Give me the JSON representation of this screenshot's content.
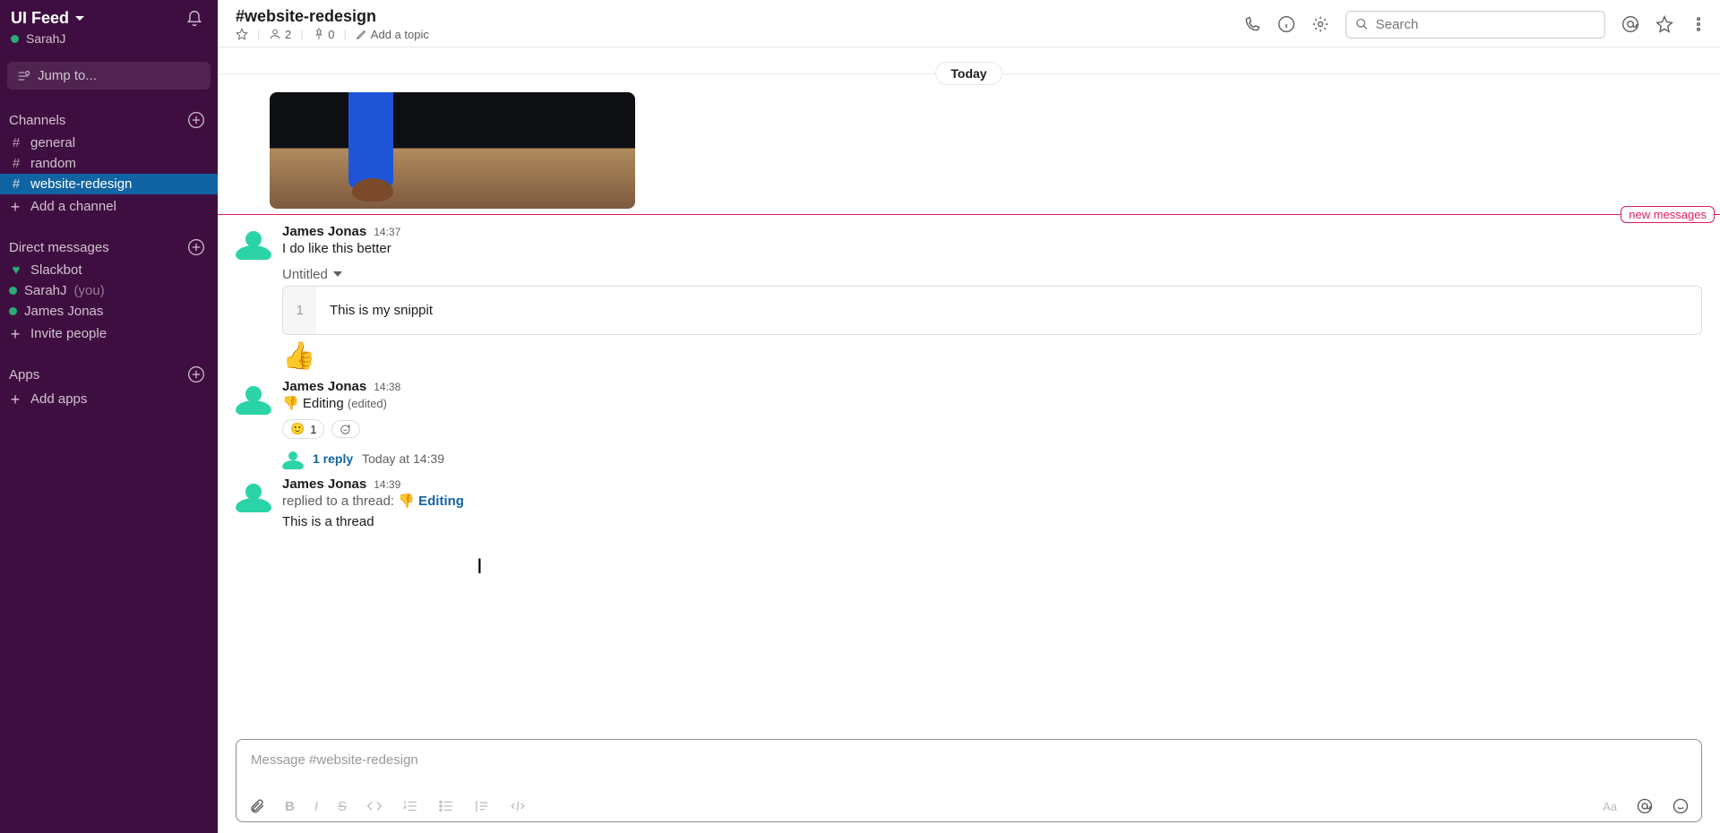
{
  "workspace": {
    "name": "UI Feed",
    "user": "SarahJ"
  },
  "jump_placeholder": "Jump to...",
  "sections": {
    "channels": {
      "title": "Channels",
      "add": "Add a channel"
    },
    "dms": {
      "title": "Direct messages",
      "add": "Invite people"
    },
    "apps": {
      "title": "Apps",
      "add": "Add apps"
    }
  },
  "channels": [
    {
      "name": "general"
    },
    {
      "name": "random"
    },
    {
      "name": "website-redesign",
      "active": true
    }
  ],
  "dms": [
    {
      "name": "Slackbot",
      "presence": "heart"
    },
    {
      "name": "SarahJ",
      "you": "(you)"
    },
    {
      "name": "James Jonas"
    }
  ],
  "header": {
    "title": "#website-redesign",
    "members": "2",
    "pins": "0",
    "topic_hint": "Add a topic",
    "search_placeholder": "Search"
  },
  "divider": "Today",
  "new_label": "new messages",
  "messages": {
    "m1": {
      "author": "James Jonas",
      "time": "14:37",
      "text": "I do like this better",
      "snip_label": "Untitled",
      "snip_line_no": "1",
      "snip_code": "This is my snippit",
      "emoji": "👍"
    },
    "m2": {
      "author": "James Jonas",
      "time": "14:38",
      "emoji": "👎",
      "text": "Editing",
      "edited": "(edited)",
      "react_emoji": "🙂",
      "react_count": "1",
      "reply_count": "1 reply",
      "reply_time": "Today at 14:39"
    },
    "m3": {
      "author": "James Jonas",
      "time": "14:39",
      "prefix": "replied to a thread:",
      "ref_emoji": "👎",
      "ref_text": "Editing",
      "body": "This is a thread"
    }
  },
  "composer": {
    "placeholder": "Message #website-redesign"
  }
}
